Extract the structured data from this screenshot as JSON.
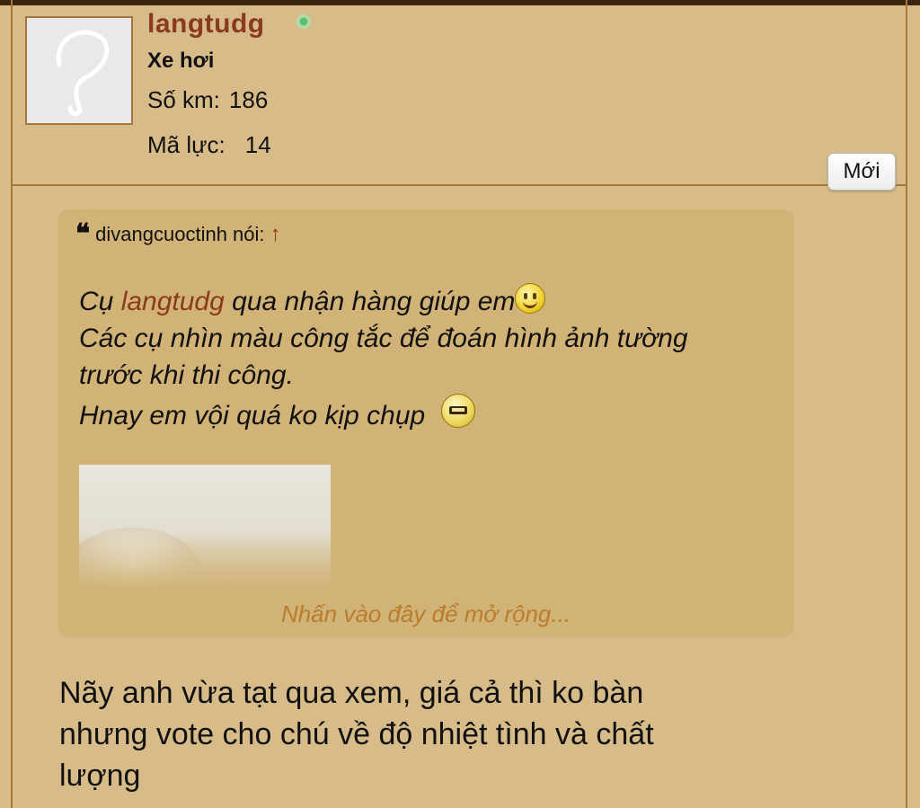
{
  "post": {
    "username": "langtudg",
    "user_title": "Xe hơi",
    "stats": {
      "km_label": "Số km:",
      "km_value": "186",
      "hp_label": "Mã lực:",
      "hp_value": "14"
    },
    "new_label": "Mới"
  },
  "quote": {
    "author_text": "divangcuoctinh nói:",
    "arrow": "↑",
    "line1_before": "Cụ ",
    "line1_mention": "langtudg",
    "line1_after": " qua nhận hàng giúp em",
    "line2": "Các cụ nhìn màu công tắc để đoán hình ảnh tường",
    "line3": "trước khi thi công.",
    "line4": "Hnay em vội quá ko kịp chụp",
    "expand_text": "Nhấn vào đây để mở rộng..."
  },
  "reply": {
    "line1": "Nãy anh vừa tạt qua xem, giá cả thì ko bàn",
    "line2": "nhưng vote cho chú về độ nhiệt tình và chất",
    "line3": "lượng"
  },
  "colors": {
    "background": "#d7bc8a",
    "quote_background": "#d1b377",
    "username": "#8b3a1d",
    "expand_link": "#b87d2d",
    "frame": "#a87838"
  },
  "icons": {
    "online": "online-status-icon",
    "avatar": "default-avatar-question-icon",
    "quote": "quote-marks-icon",
    "smile": "smile-emoji-icon",
    "embarrassed": "embarrassed-emoji-icon"
  }
}
